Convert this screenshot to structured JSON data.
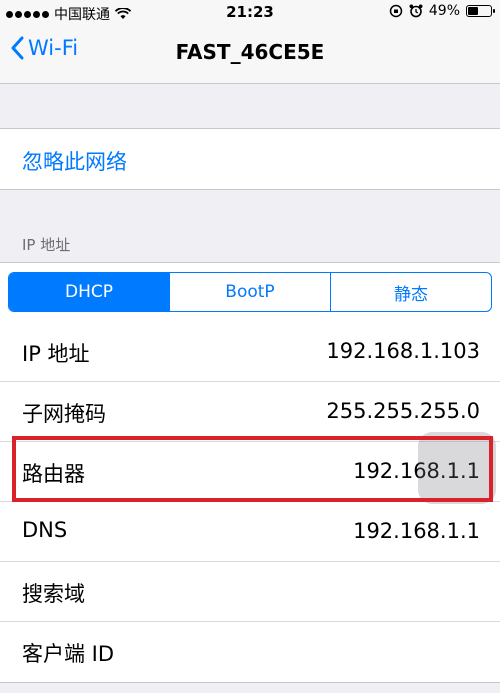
{
  "status_bar": {
    "carrier": "中国联通",
    "time": "21:23",
    "battery": "49%",
    "battery_level": 0.49,
    "icons": [
      "signal-dots-icon",
      "wifi-icon",
      "orientation-lock-icon",
      "alarm-icon",
      "battery-icon"
    ]
  },
  "nav": {
    "back_label": "Wi-Fi",
    "title": "FAST_46CE5E"
  },
  "forget_network": "忽略此网络",
  "ip_section": {
    "header": "IP 地址",
    "segments": [
      "DHCP",
      "BootP",
      "静态"
    ],
    "selected": "DHCP"
  },
  "rows": [
    {
      "label": "IP 地址",
      "value": "192.168.1.103"
    },
    {
      "label": "子网掩码",
      "value": "255.255.255.0"
    },
    {
      "label": "路由器",
      "value": "192.168.1.1"
    },
    {
      "label": "DNS",
      "value": "192.168.1.1"
    },
    {
      "label": "搜索域",
      "value": ""
    },
    {
      "label": "客户端 ID",
      "value": ""
    }
  ],
  "colors": {
    "accent": "#007aff",
    "highlight_box": "#d9222a",
    "background": "#efeff4"
  }
}
